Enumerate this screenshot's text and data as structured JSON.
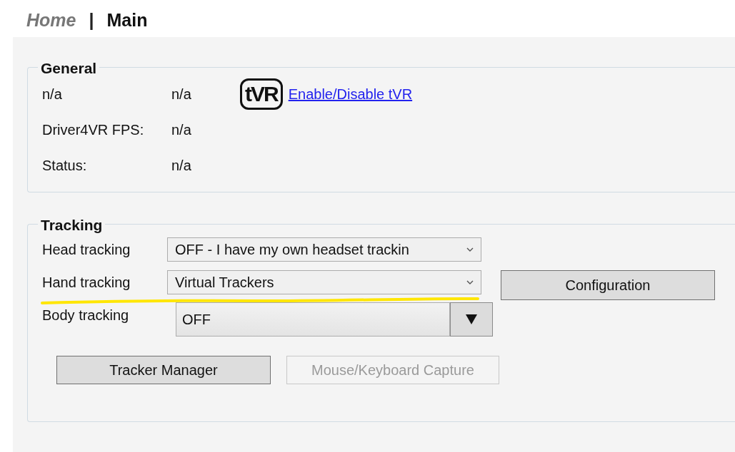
{
  "breadcrumb": [
    {
      "label": "Home",
      "selected": false
    },
    {
      "label": "Main",
      "selected": true
    }
  ],
  "breadcrumb_separator": "|",
  "general": {
    "title": "General",
    "logo": "tVR",
    "link": "Enable/Disable tVR",
    "rows": [
      {
        "label": "n/a",
        "value": "n/a"
      },
      {
        "label": "Driver4VR FPS:",
        "value": "n/a"
      },
      {
        "label": "Status:",
        "value": "n/a"
      }
    ]
  },
  "tracking": {
    "title": "Tracking",
    "rows": [
      {
        "label": "Head tracking",
        "kind": "combo",
        "value": "OFF - I have my own headset trackin",
        "highlighted": false
      },
      {
        "label": "Hand tracking",
        "kind": "combo",
        "value": "Virtual Trackers",
        "highlighted": true,
        "button": {
          "label": "Configuration",
          "disabled": false
        }
      },
      {
        "label": "Body tracking",
        "kind": "dropdown",
        "value": "OFF",
        "highlighted": false
      }
    ],
    "buttons": [
      {
        "label": "Tracker Manager",
        "disabled": false
      },
      {
        "label": "Mouse/Keyboard Capture",
        "disabled": true
      }
    ]
  }
}
